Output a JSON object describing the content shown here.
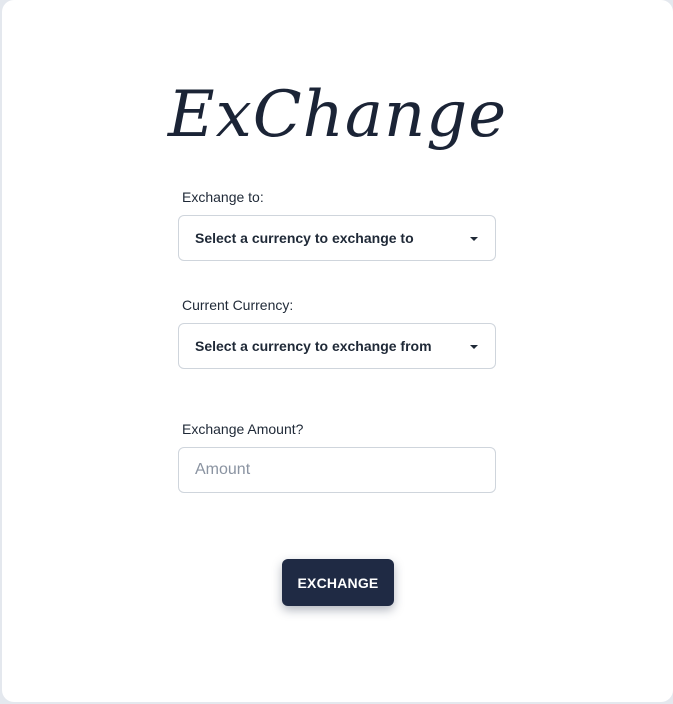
{
  "app": {
    "logo_text": "ExChange"
  },
  "form": {
    "exchange_to": {
      "label": "Exchange to:",
      "selected": "Select a currency to exchange to"
    },
    "current_currency": {
      "label": "Current Currency:",
      "selected": "Select a currency to exchange from"
    },
    "amount": {
      "label": "Exchange Amount?",
      "value": "",
      "placeholder": "Amount"
    },
    "submit_label": "EXCHANGE"
  },
  "icons": {
    "dropdown": "caret-down-icon"
  },
  "colors": {
    "primary": "#1f2a44",
    "text": "#1f2937",
    "border": "#cfd5dc",
    "placeholder": "#8a93a1"
  }
}
